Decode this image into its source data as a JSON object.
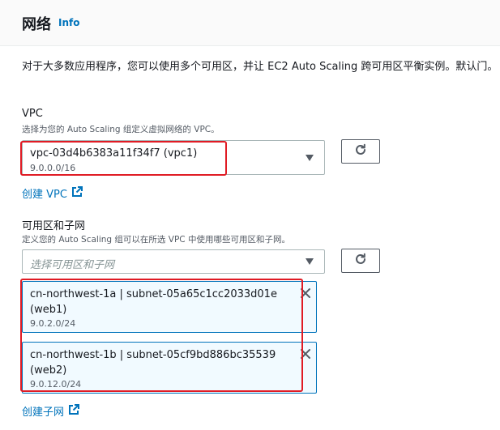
{
  "header": {
    "title": "网络",
    "info_label": "Info"
  },
  "description": "对于大多数应用程序，您可以使用多个可用区，并让 EC2 Auto Scaling 跨可用区平衡实例。默认门。",
  "vpc": {
    "label": "VPC",
    "hint": "选择为您的 Auto Scaling 组定义虚拟网络的 VPC。",
    "selected_name": "vpc-03d4b6383a11f34f7 (vpc1)",
    "selected_cidr": "9.0.0.0/16",
    "create_link": "创建 VPC"
  },
  "subnets": {
    "label": "可用区和子网",
    "hint": "定义您的 Auto Scaling 组可以在所选 VPC 中使用哪些可用区和子网。",
    "placeholder": "选择可用区和子网",
    "selected": [
      {
        "name": "cn-northwest-1a | subnet-05a65c1cc2033d01e (web1)",
        "cidr": "9.0.2.0/24"
      },
      {
        "name": "cn-northwest-1b | subnet-05cf9bd886bc35539 (web2)",
        "cidr": "9.0.12.0/24"
      }
    ],
    "create_link": "创建子网"
  },
  "icons": {
    "refresh": "refresh-icon",
    "external": "external-link-icon",
    "caret": "caret-down-icon",
    "close": "close-icon"
  },
  "colors": {
    "link": "#0073bb",
    "highlight": "#e01b24",
    "token_bg": "#f1faff"
  }
}
